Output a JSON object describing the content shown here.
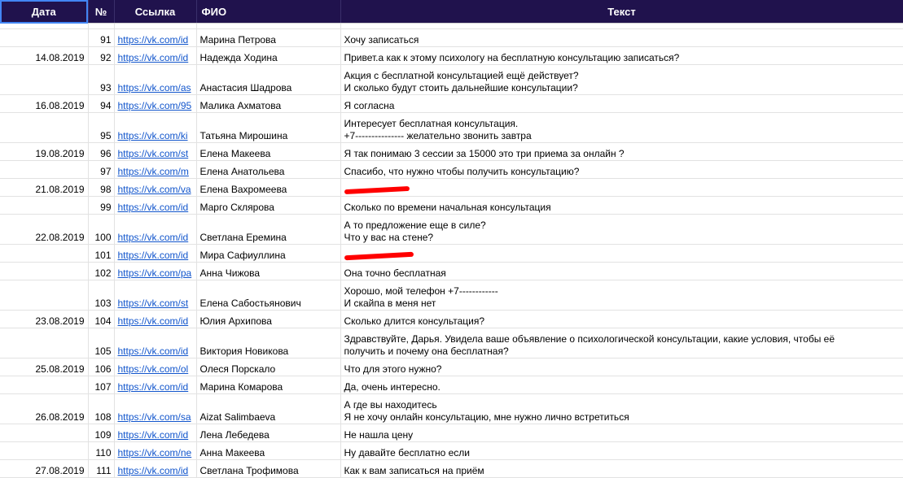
{
  "headers": {
    "date": "Дата",
    "num": "№",
    "link": "Ссылка",
    "fio": "ФИО",
    "text": "Текст"
  },
  "rows": [
    {
      "date": "",
      "num": "91",
      "link": "https://vk.com/id",
      "fio": "Марина  Петрова",
      "text": "Хочу записаться"
    },
    {
      "date": "14.08.2019",
      "num": "92",
      "link": "https://vk.com/id",
      "fio": "Надежда  Ходина",
      "text": "Привет.а как к этому психологу на бесплатную консультацию записаться?"
    },
    {
      "date": "",
      "num": "93",
      "link": "https://vk.com/as",
      "fio": "Анастасия  Шадрова",
      "text": "Акция с бесплатной консультацией ещё действует?\nИ сколько будут стоить дальнейшие консультации?"
    },
    {
      "date": "16.08.2019",
      "num": "94",
      "link": "https://vk.com/95",
      "fio": "Малика  Ахматова",
      "text": "Я согласна"
    },
    {
      "date": "",
      "num": "95",
      "link": "https://vk.com/ki",
      "fio": "Татьяна  Мирошина",
      "text": "Интересует бесплатная консультация.\n+7‑‑‑‑‑‑‑‑‑‑‑‑‑‑‑ желательно звонить завтра"
    },
    {
      "date": "19.08.2019",
      "num": "96",
      "link": "https://vk.com/st",
      "fio": "Елена  Макеева",
      "text": "Я так понимаю 3 сессии за 15000 это три приема за онлайн ?"
    },
    {
      "date": "",
      "num": "97",
      "link": "https://vk.com/m",
      "fio": "Елена  Анатольева",
      "text": "Спасибо, что нужно чтобы получить консультацию?"
    },
    {
      "date": "21.08.2019",
      "num": "98",
      "link": "https://vk.com/va",
      "fio": "Елена  Вахромеева",
      "text": ""
    },
    {
      "date": "",
      "num": "99",
      "link": "https://vk.com/id",
      "fio": "Марго  Склярова",
      "text": "Сколько по времени начальная консультация"
    },
    {
      "date": "22.08.2019",
      "num": "100",
      "link": "https://vk.com/id",
      "fio": "Светлана  Еремина",
      "text": "А то предложение еще в силе?\nЧто у вас на стене?"
    },
    {
      "date": "",
      "num": "101",
      "link": "https://vk.com/id",
      "fio": "Мира  Сафиуллина",
      "text": ""
    },
    {
      "date": "",
      "num": "102",
      "link": "https://vk.com/pa",
      "fio": "Анна  Чижова",
      "text": "Она точно бесплатная"
    },
    {
      "date": "",
      "num": "103",
      "link": "https://vk.com/st",
      "fio": "Елена  Сабостьянович",
      "text": "Хорошо, мой телефон +7‑‑‑‑‑‑‑‑‑‑‑‑\nИ скайпа в меня нет"
    },
    {
      "date": "23.08.2019",
      "num": "104",
      "link": "https://vk.com/id",
      "fio": "Юлия  Архипова",
      "text": "Сколько длится консультация?"
    },
    {
      "date": "",
      "num": "105",
      "link": "https://vk.com/id",
      "fio": "Виктория Новикова",
      "text": "Здравствуйте, Дарья. Увидела ваше объявление о психологической консультации, какие условия, чтобы её\nполучить и почему она бесплатная?"
    },
    {
      "date": "25.08.2019",
      "num": "106",
      "link": "https://vk.com/ol",
      "fio": "Олеся  Порскало",
      "text": "Что для этого нужно?"
    },
    {
      "date": "",
      "num": "107",
      "link": "https://vk.com/id",
      "fio": "Марина  Комарова",
      "text": "Да, очень интересно."
    },
    {
      "date": "26.08.2019",
      "num": "108",
      "link": "https://vk.com/sa",
      "fio": "Aizat Salimbaeva",
      "text": "А где вы находитесь\nЯ не хочу онлайн консультацию, мне нужно лично встретиться"
    },
    {
      "date": "",
      "num": "109",
      "link": "https://vk.com/id",
      "fio": "Лена  Лебедева",
      "text": "Не нашла цену"
    },
    {
      "date": "",
      "num": "110",
      "link": "https://vk.com/ne",
      "fio": "Анна  Макеева",
      "text": "Ну давайте бесплатно если"
    },
    {
      "date": "27.08.2019",
      "num": "111",
      "link": "https://vk.com/id",
      "fio": "Светлана Трофимова",
      "text": "Как к вам записаться на приём"
    }
  ]
}
